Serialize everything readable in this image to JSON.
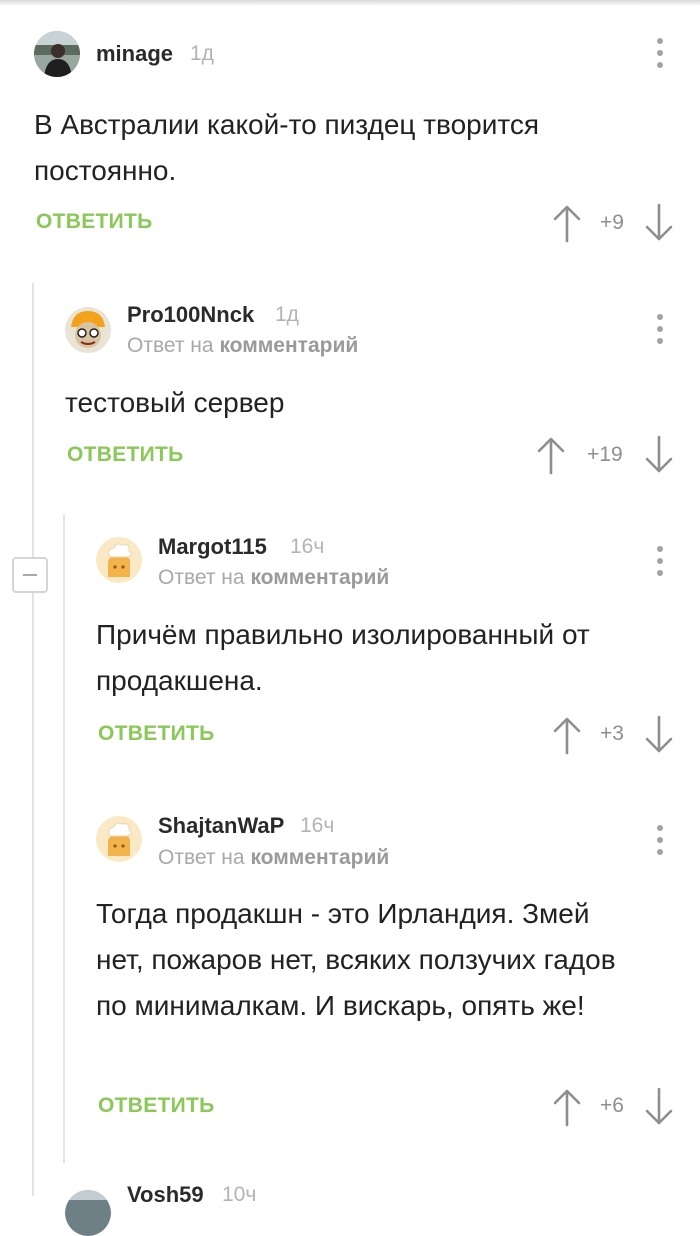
{
  "comments": [
    {
      "author": "minage",
      "time": "1д",
      "reply_prefix": "",
      "reply_target": "",
      "text": "В Австралии какой-то пиздец творится постоянно.",
      "reply_label": "ОТВЕТИТЬ",
      "score": "+9"
    },
    {
      "author": "Pro100Nnck",
      "time": "1д",
      "reply_prefix": "Ответ на",
      "reply_target": "комментарий",
      "text": "тестовый сервер",
      "reply_label": "ОТВЕТИТЬ",
      "score": "+19"
    },
    {
      "author": "Margot115",
      "time": "16ч",
      "reply_prefix": "Ответ на",
      "reply_target": "комментарий",
      "text": "Причём правильно изолированный от продакшена.",
      "reply_label": "ОТВЕТИТЬ",
      "score": "+3"
    },
    {
      "author": "ShajtanWaP",
      "time": "16ч",
      "reply_prefix": "Ответ на",
      "reply_target": "комментарий",
      "text": "Тогда продакшн - это Ирландия. Змей нет, пожаров нет, всяких ползучих гадов по минималкам. И вискарь, опять же!",
      "reply_label": "ОТВЕТИТЬ",
      "score": "+6"
    },
    {
      "author": "Vosh59",
      "time": "10ч"
    }
  ],
  "icons": {
    "upvote": "arrow-up-icon",
    "downvote": "arrow-down-icon",
    "menu": "more-vertical-icon",
    "collapse": "minus-icon"
  },
  "colors": {
    "accent_green": "#8ac858",
    "thread_line": "#e3e3e3",
    "muted_text": "#a8a8a8"
  }
}
